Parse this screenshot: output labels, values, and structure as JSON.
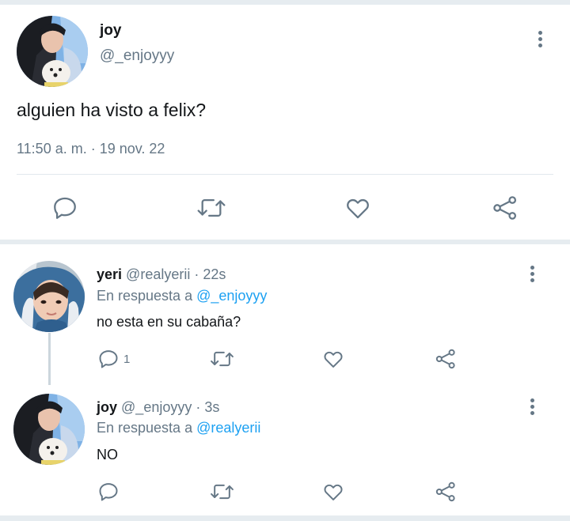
{
  "main_tweet": {
    "author_name": "joy",
    "author_handle": "@_enjoyyy",
    "text": "alguien ha visto a felix?",
    "timestamp": "11:50 a. m. · 19 nov. 22",
    "actions": [
      "reply-icon",
      "retweet-icon",
      "like-icon",
      "share-icon"
    ]
  },
  "replies": [
    {
      "author_name": "yeri",
      "author_handle": "@realyerii",
      "time": "· 22s",
      "reply_prefix": "En respuesta a",
      "reply_to": "@_enjoyyy",
      "text": "no esta en su cabaña?",
      "reply_count": "1"
    },
    {
      "author_name": "joy",
      "author_handle": "@_enjoyyy",
      "time": "· 3s",
      "reply_prefix": "En respuesta a",
      "reply_to": "@realyerii",
      "text": "NO",
      "reply_count": ""
    }
  ],
  "colors": {
    "accent": "#1da1f2",
    "muted": "#657786",
    "text": "#14171a",
    "background": "#e6ecf0"
  }
}
